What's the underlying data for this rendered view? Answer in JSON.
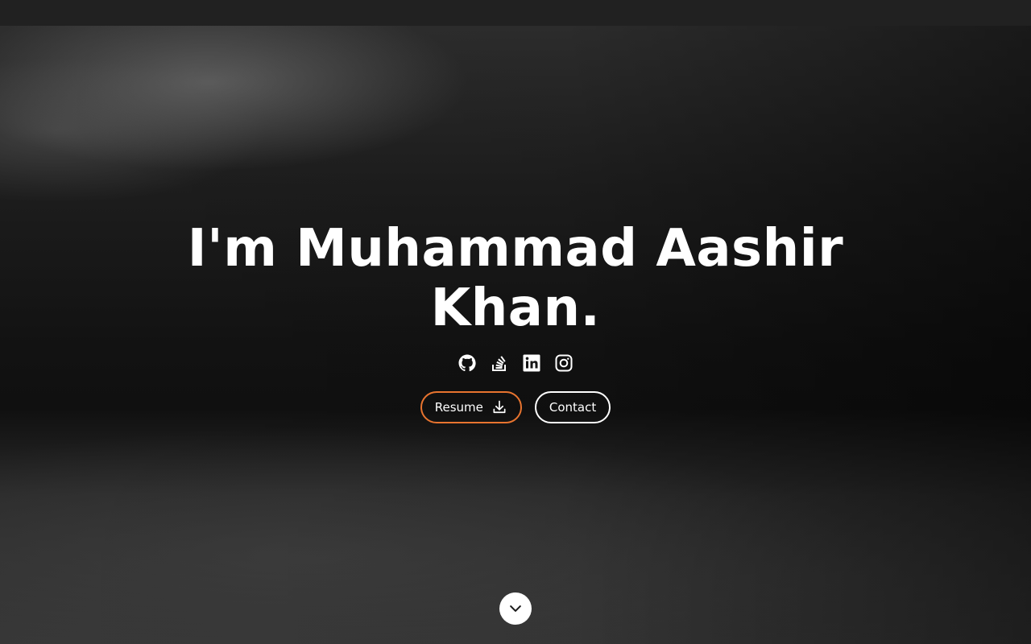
{
  "hero": {
    "title": "I'm Muhammad Aashir Khan."
  },
  "socials": [
    {
      "icon": "github-icon"
    },
    {
      "icon": "stackoverflow-icon"
    },
    {
      "icon": "linkedin-icon"
    },
    {
      "icon": "instagram-icon"
    }
  ],
  "buttons": {
    "resume_label": "Resume",
    "resume_icon": "download-icon",
    "contact_label": "Contact"
  },
  "scroll": {
    "icon": "chevron-down-icon"
  },
  "colors": {
    "accent": "#e8742f",
    "text": "#ffffff",
    "topbar": "#212121"
  }
}
